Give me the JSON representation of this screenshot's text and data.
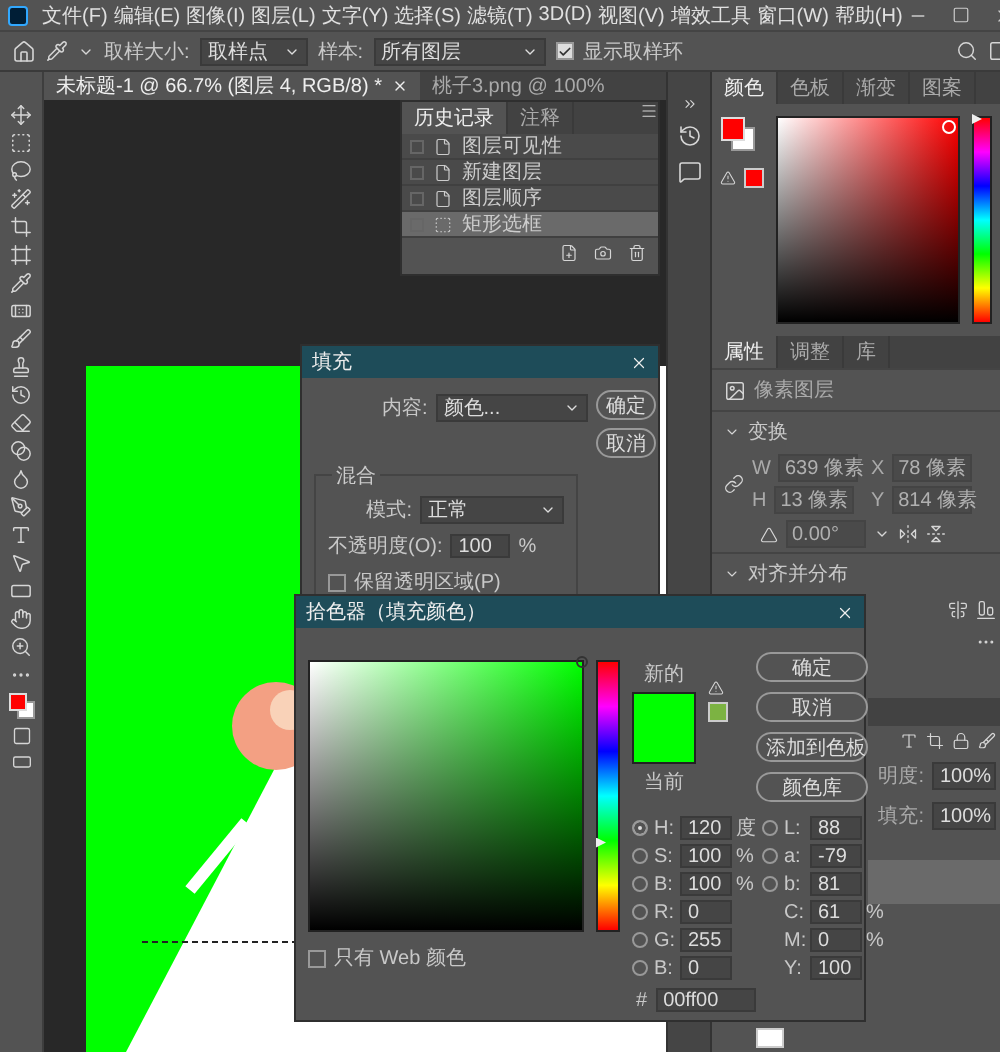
{
  "menu": [
    "文件(F)",
    "编辑(E)",
    "图像(I)",
    "图层(L)",
    "文字(Y)",
    "选择(S)",
    "滤镜(T)",
    "3D(D)",
    "视图(V)",
    "增效工具",
    "窗口(W)",
    "帮助(H)"
  ],
  "options_bar": {
    "sample_size_label": "取样大小:",
    "sample_size": "取样点",
    "sample_label": "样本:",
    "sample": "所有图层",
    "show_ring": {
      "label": "显示取样环",
      "checked": true
    }
  },
  "doc_tabs": [
    {
      "label": "未标题-1 @ 66.7% (图层 4, RGB/8) *",
      "selected": true,
      "closable": true
    },
    {
      "label": "桃子3.png @ 100%",
      "selected": false,
      "closable": false
    }
  ],
  "history": {
    "tabs": [
      {
        "label": "历史记录",
        "selected": true
      },
      {
        "label": "注释",
        "selected": false
      }
    ],
    "items": [
      {
        "label": "图层可见性",
        "kind": "document",
        "selected": false
      },
      {
        "label": "新建图层",
        "kind": "document",
        "selected": false
      },
      {
        "label": "图层顺序",
        "kind": "document",
        "selected": false
      },
      {
        "label": "矩形选框",
        "kind": "marquee",
        "selected": true
      }
    ]
  },
  "color_panel": {
    "tabs": [
      {
        "label": "颜色",
        "selected": true
      },
      {
        "label": "色板",
        "selected": false
      },
      {
        "label": "渐变",
        "selected": false
      },
      {
        "label": "图案",
        "selected": false
      }
    ]
  },
  "properties": {
    "tabs": [
      {
        "label": "属性",
        "selected": true
      },
      {
        "label": "调整",
        "selected": false
      },
      {
        "label": "库",
        "selected": false
      }
    ],
    "layer_type": "像素图层",
    "transform_title": "变换",
    "fields": [
      {
        "label": "W",
        "value": "639 像素"
      },
      {
        "label": "X",
        "value": "78 像素"
      },
      {
        "label": "H",
        "value": "13 像素"
      },
      {
        "label": "Y",
        "value": "814 像素"
      }
    ],
    "angle": "0.00°",
    "align_title": "对齐并分布"
  },
  "layers": {
    "opacity_label": "明度:",
    "opacity": "100%",
    "fill_label": "填充:",
    "fill": "100%"
  },
  "fill_dialog": {
    "title": "填充",
    "content_label": "内容:",
    "content": "颜色...",
    "buttons": [
      "确定",
      "取消"
    ],
    "blend_title": "混合",
    "mode_label": "模式:",
    "mode": "正常",
    "opacity_label": "不透明度(O):",
    "opacity": "100",
    "opacity_unit": "%",
    "preserve": {
      "label": "保留透明区域(P)",
      "checked": false
    }
  },
  "color_picker": {
    "title": "拾色器（填充颜色）",
    "new_label": "新的",
    "current_label": "当前",
    "buttons": [
      "确定",
      "取消",
      "添加到色板",
      "颜色库"
    ],
    "web_only": {
      "label": "只有 Web 颜色",
      "checked": false
    },
    "left_fields": [
      {
        "label": "H:",
        "value": "120",
        "unit": "度",
        "kind": "radio",
        "selected": true
      },
      {
        "label": "S:",
        "value": "100",
        "unit": "%",
        "kind": "radio",
        "selected": false
      },
      {
        "label": "B:",
        "value": "100",
        "unit": "%",
        "kind": "radio",
        "selected": false
      },
      {
        "label": "R:",
        "value": "0",
        "kind": "radio",
        "selected": false
      },
      {
        "label": "G:",
        "value": "255",
        "kind": "radio",
        "selected": false
      },
      {
        "label": "B:",
        "value": "0",
        "kind": "radio",
        "selected": false
      }
    ],
    "right_fields": [
      {
        "label": "L:",
        "value": "88",
        "kind": "radio",
        "selected": false
      },
      {
        "label": "a:",
        "value": "-79",
        "kind": "radio",
        "selected": false
      },
      {
        "label": "b:",
        "value": "81",
        "kind": "radio",
        "selected": false
      },
      {
        "label": "C:",
        "value": "61",
        "unit": "%",
        "kind": "plain"
      },
      {
        "label": "M:",
        "value": "0",
        "unit": "%",
        "kind": "plain"
      },
      {
        "label": "Y:",
        "value": "100",
        "kind": "plain"
      }
    ],
    "hex_label": "#",
    "hex": "00ff00"
  }
}
